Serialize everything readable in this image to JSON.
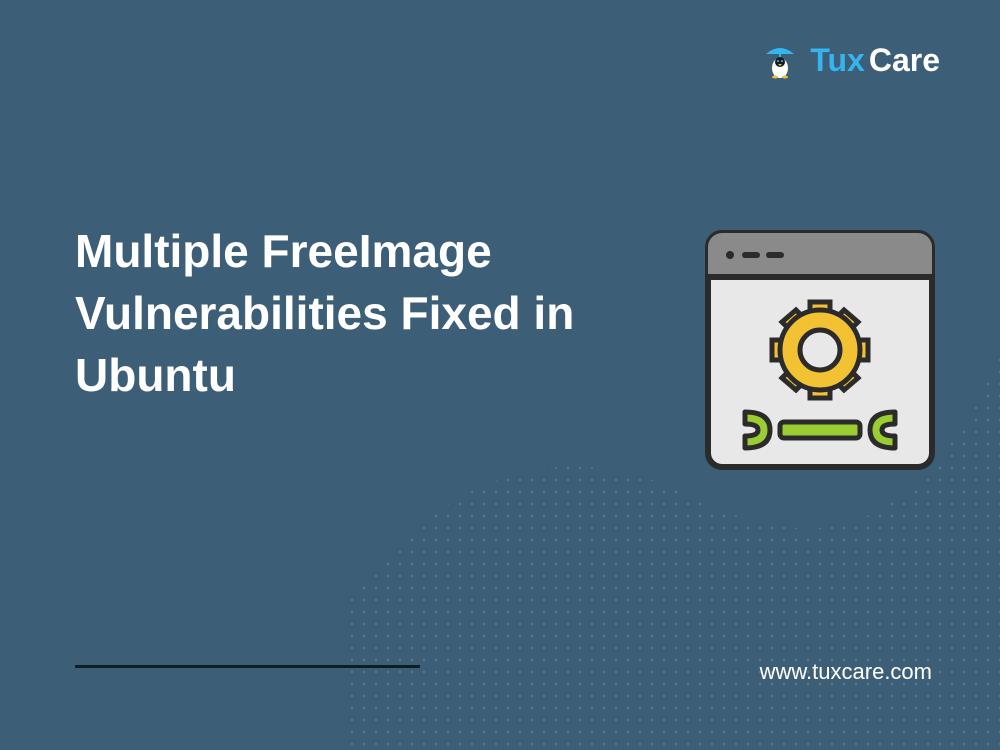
{
  "brand": {
    "tux": "Tux",
    "care": "Care"
  },
  "headline": "Multiple FreeImage Vulnerabilities Fixed in Ubuntu",
  "website": "www.tuxcare.com",
  "colors": {
    "bg": "#3c5e77",
    "accent": "#35b4ef",
    "gear": "#f2c233",
    "wrench": "#9acd32"
  }
}
